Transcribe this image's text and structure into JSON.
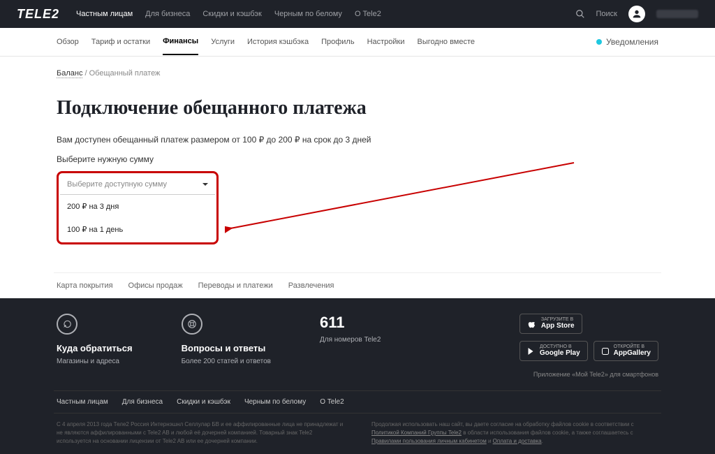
{
  "logo": "TELE2",
  "topnav": [
    "Частным лицам",
    "Для бизнеса",
    "Скидки и кэшбэк",
    "Черным по белому",
    "О Tele2"
  ],
  "search": "Поиск",
  "subnav": [
    "Обзор",
    "Тариф и остатки",
    "Финансы",
    "Услуги",
    "История кэшбэка",
    "Профиль",
    "Настройки",
    "Выгодно вместе"
  ],
  "subnav_active_index": 2,
  "notifications": "Уведомления",
  "breadcrumb": {
    "link": "Баланс",
    "current": "Обещанный платеж"
  },
  "title": "Подключение обещанного платежа",
  "desc": "Вам доступен обещанный платеж размером от 100 ₽ до 200 ₽ на срок до 3 дней",
  "label": "Выберите нужную сумму",
  "select": {
    "placeholder": "Выберите доступную сумму",
    "options": [
      "200 ₽ на 3 дня",
      "100 ₽ на 1 день"
    ]
  },
  "footer_links": [
    "Карта покрытия",
    "Офисы продаж",
    "Переводы и платежи",
    "Развлечения"
  ],
  "contact": {
    "title": "Куда обратиться",
    "sub": "Магазины и адреса"
  },
  "faq": {
    "title": "Вопросы и ответы",
    "sub": "Более 200 статей и ответов"
  },
  "phone": {
    "num": "611",
    "sub": "Для номеров Tele2"
  },
  "stores": {
    "appstore": {
      "small": "ЗАГРУЗИТЕ В",
      "big": "App Store"
    },
    "gplay": {
      "small": "ДОСТУПНО В",
      "big": "Google Play"
    },
    "appgallery": {
      "small": "ОТКРОЙТЕ В",
      "big": "AppGallery"
    }
  },
  "appnote": "Приложение «Мой Tele2» для смартфонов",
  "darknav": [
    "Частным лицам",
    "Для бизнеса",
    "Скидки и кэшбэк",
    "Черным по белому",
    "О Tele2"
  ],
  "legal1": "С 4 апреля 2013 года Теле2 Россия Интернэшнл Селлулар БВ и ее аффилированные лица не принадлежат и не являются аффилированными с Tele2 AB и любой её дочерней компанией. Товарный знак Tele2 используется на основании лицензии от Tele2 AB или ее дочерней компании.",
  "legal2_a": "Продолжая использовать наш сайт, вы даете согласие на обработку файлов cookie в соответствии с",
  "legal2_link1": "Политикой Компаний Группы Tele2",
  "legal2_b": "в области использования файлов cookie, а также соглашаетесь с",
  "legal2_link2": "Правилами пользования личным кабинетом",
  "legal2_c": "и",
  "legal2_link3": "Оплата и доставка"
}
